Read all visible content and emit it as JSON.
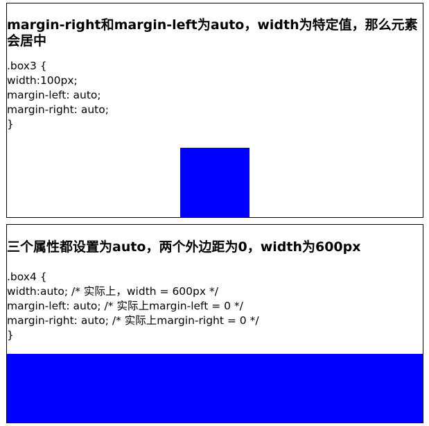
{
  "section1": {
    "heading": "margin-right和margin-left为auto，width为特定值，那么元素会居中",
    "code_lines": [
      ".box3 {",
      "width:100px;",
      "margin-left: auto;",
      "margin-right: auto;",
      "}"
    ],
    "box_color": "#0000ff"
  },
  "section2": {
    "heading": "三个属性都设置为auto，两个外边距为0，width为600px",
    "code_lines": [
      ".box4 {",
      "width:auto; /* 实际上，width = 600px */",
      "margin-left: auto; /* 实际上margin-left = 0 */",
      "margin-right: auto; /* 实际上margin-right = 0 */",
      "}"
    ],
    "box_color": "#0000ff"
  }
}
